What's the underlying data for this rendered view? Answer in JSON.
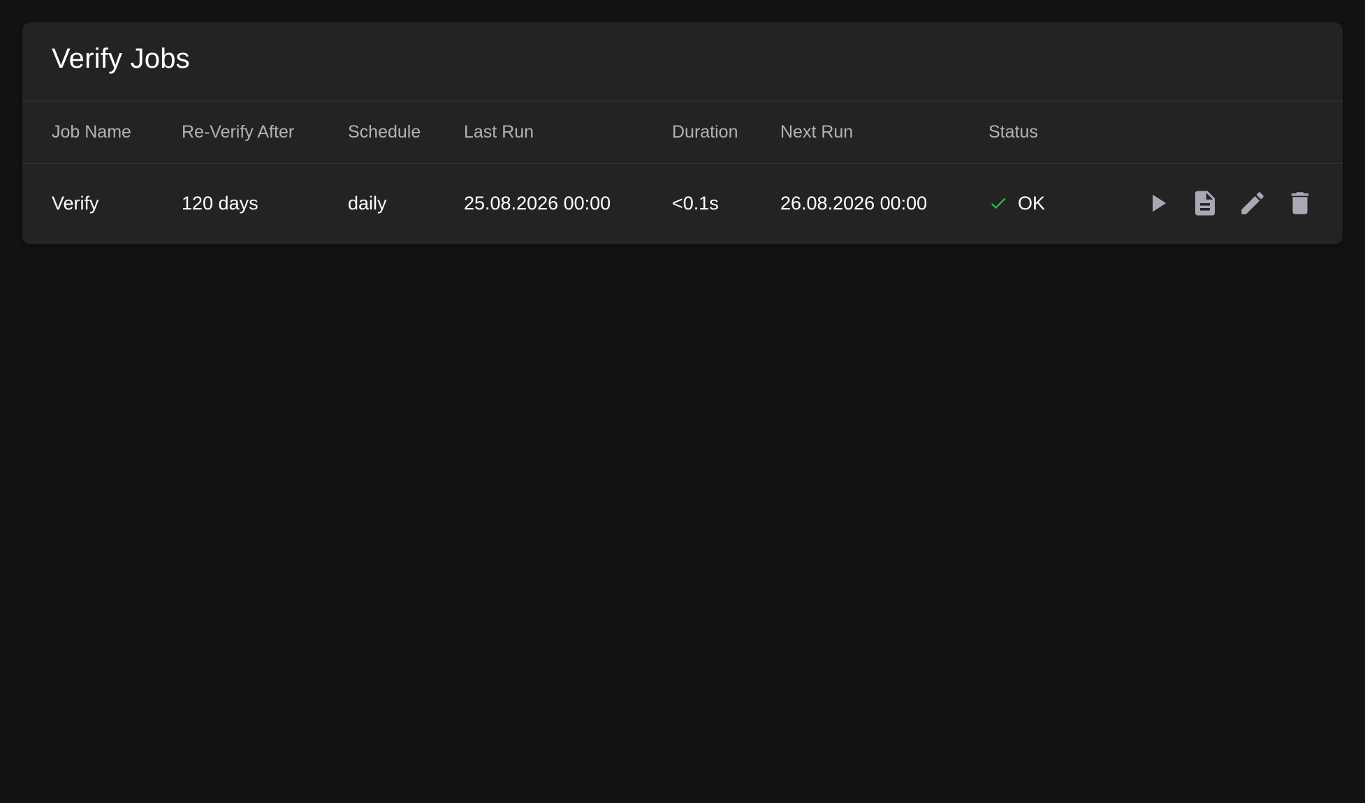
{
  "card": {
    "title": "Verify Jobs"
  },
  "table": {
    "columns": [
      "Job Name",
      "Re-Verify After",
      "Schedule",
      "Last Run",
      "Duration",
      "Next Run",
      "Status"
    ],
    "rows": [
      {
        "job_name": "Verify",
        "reverify_after": "120 days",
        "schedule": "daily",
        "last_run": "25.08.2026 00:00",
        "duration": "<0.1s",
        "next_run": "26.08.2026 00:00",
        "status": "OK",
        "status_icon": "check-icon"
      }
    ]
  },
  "actions": [
    {
      "name": "run-icon"
    },
    {
      "name": "log-file-icon"
    },
    {
      "name": "edit-icon"
    },
    {
      "name": "delete-icon"
    }
  ],
  "colors": {
    "background": "#121212",
    "card": "#232323",
    "status_ok": "#2fb84f",
    "action_icon": "#a9a9b6"
  }
}
